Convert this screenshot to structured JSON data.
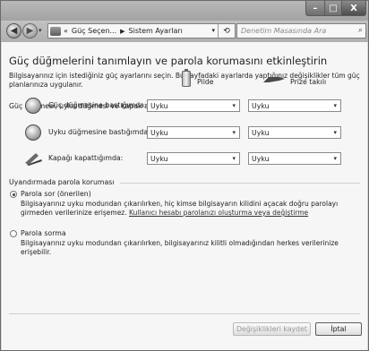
{
  "window": {
    "minimize_glyph": "–",
    "maximize_glyph": "□",
    "close_glyph": "X"
  },
  "nav": {
    "back_glyph": "◀",
    "forward_glyph": "▶",
    "address_prefix": "«",
    "breadcrumb": [
      "Güç Seçen...",
      "Sistem Ayarları"
    ],
    "breadcrumb_separator": "▶",
    "address_dropdown_glyph": "▾",
    "refresh_glyph": "⟲",
    "search_placeholder": "Denetim Masasında Ara",
    "search_glyph": "⌕"
  },
  "main": {
    "title": "Güç düğmelerini tanımlayın ve parola korumasını etkinleştirin",
    "description": "Bilgisayarınız için istediğiniz güç ayarlarını seçin. Bu sayfadaki ayarlarda yaptığınız değişiklikler tüm güç planlarınıza uygulanır.",
    "buttons_section": {
      "heading": "Güç düğmesi, uyku düğmesi ve kapak ayarları",
      "columns": {
        "battery": "Pilde",
        "plugged": "Prize takılı"
      },
      "rows": [
        {
          "label": "Güç düğmesine bastığımda:",
          "battery": "Uyku",
          "plugged": "Uyku"
        },
        {
          "label": "Uyku düğmesine bastığımda:",
          "battery": "Uyku",
          "plugged": "Uyku"
        },
        {
          "label": "Kapağı kapattığımda:",
          "battery": "Uyku",
          "plugged": "Uyku"
        }
      ],
      "caret": "▾"
    },
    "password_section": {
      "heading": "Uyandırmada parola koruması",
      "option1": {
        "title": "Parola sor (önerilen)",
        "desc": "Bilgisayarınız uyku modundan çıkarılırken, hiç kimse bilgisayarın kilidini açacak doğru parolayı girmeden verilerinize erişemez.",
        "link": "Kullanıcı hesabı parolanızı oluşturma veya değiştirme",
        "checked": true
      },
      "option2": {
        "title": "Parola sorma",
        "desc": "Bilgisayarınız uyku modundan çıkarılırken, bilgisayarınız kilitli olmadığından herkes verilerinize erişebilir.",
        "checked": false
      }
    },
    "footer": {
      "save_label": "Değişiklikleri kaydet",
      "cancel_label": "İptal"
    }
  }
}
